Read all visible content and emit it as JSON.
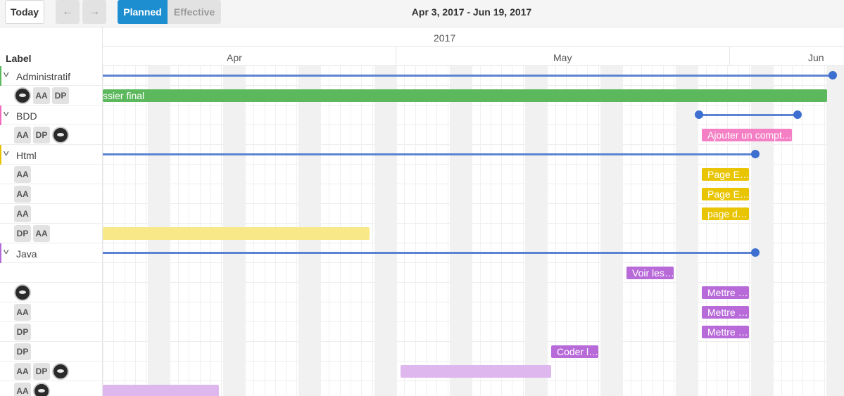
{
  "toolbar": {
    "today_label": "Today",
    "prev_icon": "←",
    "next_icon": "→",
    "planned_label": "Planned",
    "effective_label": "Effective",
    "range_title": "Apr 3, 2017 - Jun 19, 2017"
  },
  "sidebar": {
    "header": "Label",
    "groups": [
      {
        "name": "Administratif",
        "color": "#5cb85c"
      },
      {
        "name": "BDD",
        "color": "#f06bbd"
      },
      {
        "name": "Html",
        "color": "#e6c300"
      },
      {
        "name": "Java",
        "color": "#b36ad8"
      }
    ],
    "chips": {
      "aa": "AA",
      "dp": "DP"
    }
  },
  "timeline": {
    "year": "2017",
    "months": [
      "Apr",
      "May",
      "Jun"
    ]
  },
  "tasks": {
    "dossier_final": "ssier final",
    "ajouter_compte": "Ajouter un compt…",
    "page_e1": "Page E…",
    "page_e2": "Page E…",
    "page_d": "page d…",
    "voir_les": "Voir les…",
    "mettre1": "Mettre …",
    "mettre2": "Mettre …",
    "mettre3": "Mettre …",
    "coder_l": "Coder l…"
  },
  "colors": {
    "accent": "#1d8ed0",
    "summary": "#5b83d1",
    "admin_task": "#5cb85c",
    "bdd_task": "#f57fc4",
    "html_task": "#e9c400",
    "html_task_light": "#f8e887",
    "java_task": "#b86ad9",
    "java_task_light": "#dfb7ef"
  }
}
